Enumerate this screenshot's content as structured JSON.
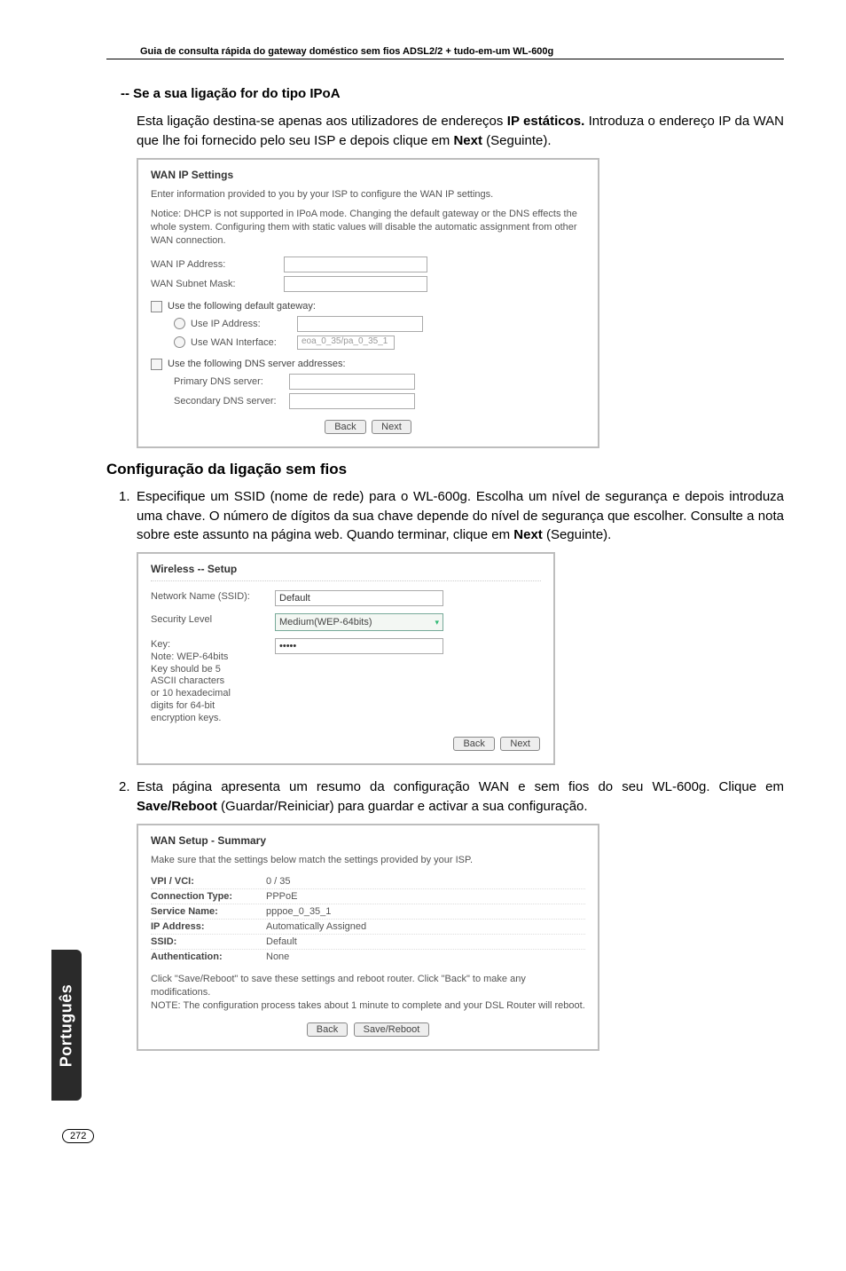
{
  "header": {
    "title": "Guia de consulta rápida do gateway doméstico sem fios ADSL2/2 + tudo-em-um WL-600g"
  },
  "sub_heading": "-- Se a sua ligação for do tipo IPoA",
  "para_ipoa_1": "Esta ligação destina-se apenas aos utilizadores de endereços ",
  "para_ipoa_bold": "IP estáticos.",
  "para_ipoa_2": " Introduza o endereço IP da WAN que lhe foi fornecido pelo seu ISP e depois clique em ",
  "para_ipoa_next": "Next",
  "para_ipoa_3": " (Seguinte).",
  "wan_dialog": {
    "title": "WAN IP Settings",
    "intro": "Enter information provided to you by your ISP to configure the WAN IP settings.",
    "notice": "Notice: DHCP is not supported in IPoA mode. Changing the default gateway or the DNS effects the whole system. Configuring them with static values will disable the automatic assignment from other WAN connection.",
    "wan_ip_label": "WAN IP Address:",
    "wan_subnet_label": "WAN Subnet Mask:",
    "use_gw_label": "Use the following default gateway:",
    "use_ip_label": "Use IP Address:",
    "use_wan_if_label": "Use WAN Interface:",
    "use_wan_if_value": "eoa_0_35/pa_0_35_1",
    "use_dns_label": "Use the following DNS server addresses:",
    "primary_dns": "Primary DNS server:",
    "secondary_dns": "Secondary DNS server:",
    "back": "Back",
    "next": "Next"
  },
  "section_heading": "Configuração da ligação sem fios",
  "step1_a": "Especifique um SSID (nome de rede) para o WL-600g. Escolha um nível de segurança e depois introduza uma chave. O número de dígitos da sua chave depende do nível de segurança que escolher. Consulte a nota sobre este assunto na página web. Quando terminar, clique em ",
  "step1_next": "Next",
  "step1_b": " (Seguinte).",
  "wireless_dialog": {
    "title": "Wireless -- Setup",
    "ssid_label": "Network Name (SSID):",
    "ssid_value": "Default",
    "sec_label": "Security Level",
    "sec_value": "Medium(WEP-64bits)",
    "key_label": "Key:",
    "key_value": "•••••",
    "key_note": "Note: WEP-64bits Key should be 5 ASCII characters or 10 hexadecimal digits for 64-bit encryption keys.",
    "back": "Back",
    "next": "Next"
  },
  "step2_a": "Esta página apresenta um resumo da configuração WAN e sem fios do seu WL-600g. Clique em ",
  "step2_bold": "Save/Reboot",
  "step2_b": " (Guardar/Reiniciar) para guardar e activar a sua configuração.",
  "summary_dialog": {
    "title": "WAN Setup - Summary",
    "intro": "Make sure that the settings below match the settings provided by your ISP.",
    "rows": [
      {
        "k": "VPI / VCI:",
        "v": "0 / 35"
      },
      {
        "k": "Connection Type:",
        "v": "PPPoE"
      },
      {
        "k": "Service Name:",
        "v": "pppoe_0_35_1"
      },
      {
        "k": "IP Address:",
        "v": "Automatically Assigned"
      },
      {
        "k": "SSID:",
        "v": "Default"
      },
      {
        "k": "Authentication:",
        "v": "None"
      }
    ],
    "foot1": "Click \"Save/Reboot\" to save these settings and reboot router. Click \"Back\" to make any modifications.",
    "foot2": "NOTE: The configuration process takes about 1 minute to complete and your DSL Router will reboot.",
    "back": "Back",
    "save": "Save/Reboot"
  },
  "side_tab": "Português",
  "page_number": "272"
}
